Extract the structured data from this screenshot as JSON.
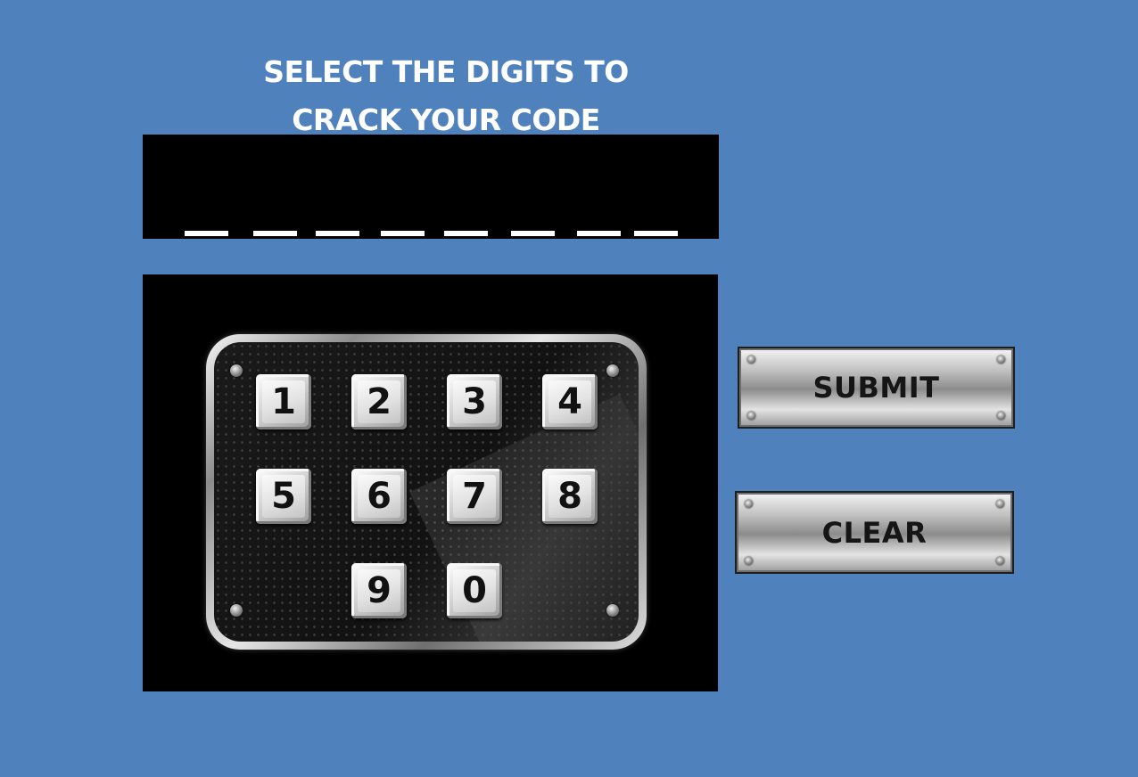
{
  "header": {
    "title_line1": "SELECT THE DIGITS TO",
    "title_line2": "CRACK YOUR CODE"
  },
  "code_display": {
    "slot_count": 8
  },
  "keypad": {
    "keys": [
      "1",
      "2",
      "3",
      "4",
      "5",
      "6",
      "7",
      "8",
      "9",
      "0"
    ]
  },
  "actions": {
    "submit_label": "SUBMIT",
    "clear_label": "CLEAR"
  },
  "colors": {
    "background": "#4f81bd",
    "panel": "#000000",
    "slot": "#ffffff"
  }
}
